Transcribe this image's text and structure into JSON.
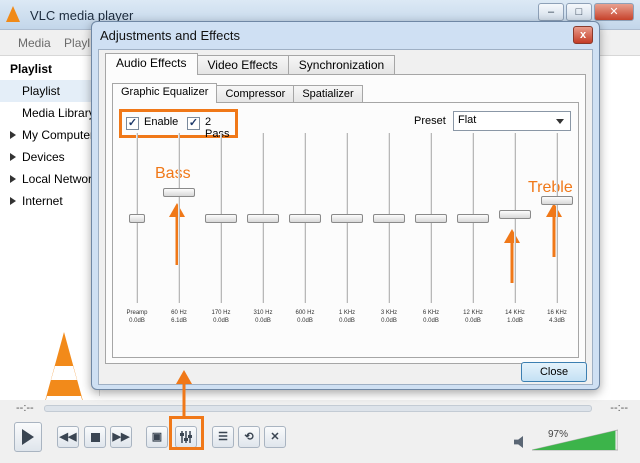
{
  "window": {
    "title": "VLC media player",
    "menu": [
      "Media",
      "Playl"
    ]
  },
  "sidebar": {
    "title": "Playlist",
    "items": [
      {
        "label": "Playlist",
        "expandable": false,
        "selected": true
      },
      {
        "label": "Media Library",
        "expandable": false,
        "selected": false
      },
      {
        "label": "My Computer",
        "expandable": true,
        "selected": false
      },
      {
        "label": "Devices",
        "expandable": true,
        "selected": false
      },
      {
        "label": "Local Network",
        "expandable": true,
        "selected": false
      },
      {
        "label": "Internet",
        "expandable": true,
        "selected": false
      }
    ]
  },
  "player": {
    "time_elapsed": "--:--",
    "time_total": "--:--",
    "volume": "97%",
    "volume_level": 0.97
  },
  "dialog": {
    "title": "Adjustments and Effects",
    "close_x": "x",
    "tabs": [
      "Audio Effects",
      "Video Effects",
      "Synchronization"
    ],
    "subtabs": [
      "Graphic Equalizer",
      "Compressor",
      "Spatializer"
    ],
    "enable_label": "Enable",
    "enable_checked": true,
    "twopass_label": "2 Pass",
    "twopass_checked": true,
    "preset_label": "Preset",
    "preset_value": "Flat",
    "close_label": "Close",
    "bands": [
      {
        "freq": "Preamp",
        "db": "0.0dB"
      },
      {
        "freq": "60 Hz",
        "db": "6.1dB"
      },
      {
        "freq": "170 Hz",
        "db": "0.0dB"
      },
      {
        "freq": "310 Hz",
        "db": "0.0dB"
      },
      {
        "freq": "600 Hz",
        "db": "0.0dB"
      },
      {
        "freq": "1 KHz",
        "db": "0.0dB"
      },
      {
        "freq": "3 KHz",
        "db": "0.0dB"
      },
      {
        "freq": "6 KHz",
        "db": "0.0dB"
      },
      {
        "freq": "12 KHz",
        "db": "0.0dB"
      },
      {
        "freq": "14 KHz",
        "db": "1.0dB"
      },
      {
        "freq": "16 KHz",
        "db": "4.3dB"
      }
    ]
  },
  "annotations": {
    "bass": "Bass",
    "treble": "Treble",
    "color": "#f07818"
  },
  "icons": [
    "vlc-cone-icon",
    "play-icon",
    "prev-icon",
    "stop-icon",
    "next-icon",
    "fullscreen-icon",
    "equalizer-icon",
    "playlist-icon",
    "loop-icon",
    "shuffle-icon",
    "speaker-icon"
  ]
}
